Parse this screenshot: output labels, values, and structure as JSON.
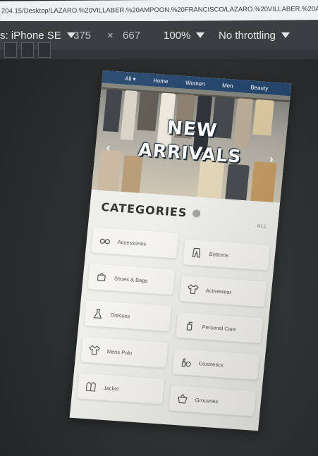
{
  "browser": {
    "url_text": "204.15/Desktop/LAZARO.%20VILLABER.%20AMPOON.%20FRANCISCO/LAZARO.%20VILLABER.%20AMPOO"
  },
  "devtools": {
    "device_label": "s: iPhone SE",
    "width": "375",
    "times": "×",
    "height": "667",
    "zoom": "100%",
    "throttle": "No throttling"
  },
  "nav": {
    "items": [
      "All ▾",
      "Home",
      "Women",
      "Men",
      "Beauty"
    ],
    "color": "#24456b"
  },
  "hero": {
    "line1": "NEW",
    "line2": "ARRIVALS",
    "prev_icon": "chevron-left-icon",
    "next_icon": "chevron-right-icon"
  },
  "categories": {
    "title": "CATEGORIES",
    "all_label": "ALL",
    "items": [
      {
        "label": "Accessories",
        "icon": "sunglasses-icon"
      },
      {
        "label": "Bottoms",
        "icon": "pants-icon"
      },
      {
        "label": "Shoes & Bags",
        "icon": "shoes-bag-icon"
      },
      {
        "label": "Activewear",
        "icon": "sports-shirt-icon"
      },
      {
        "label": "Dresses",
        "icon": "dress-icon"
      },
      {
        "label": "Personal Care",
        "icon": "spray-bottle-icon"
      },
      {
        "label": "Mens Polo",
        "icon": "polo-shirt-icon"
      },
      {
        "label": "Cosmetics",
        "icon": "cosmetics-icon"
      },
      {
        "label": "Jacket",
        "icon": "jacket-icon"
      },
      {
        "label": "Groceries",
        "icon": "basket-icon"
      }
    ]
  }
}
